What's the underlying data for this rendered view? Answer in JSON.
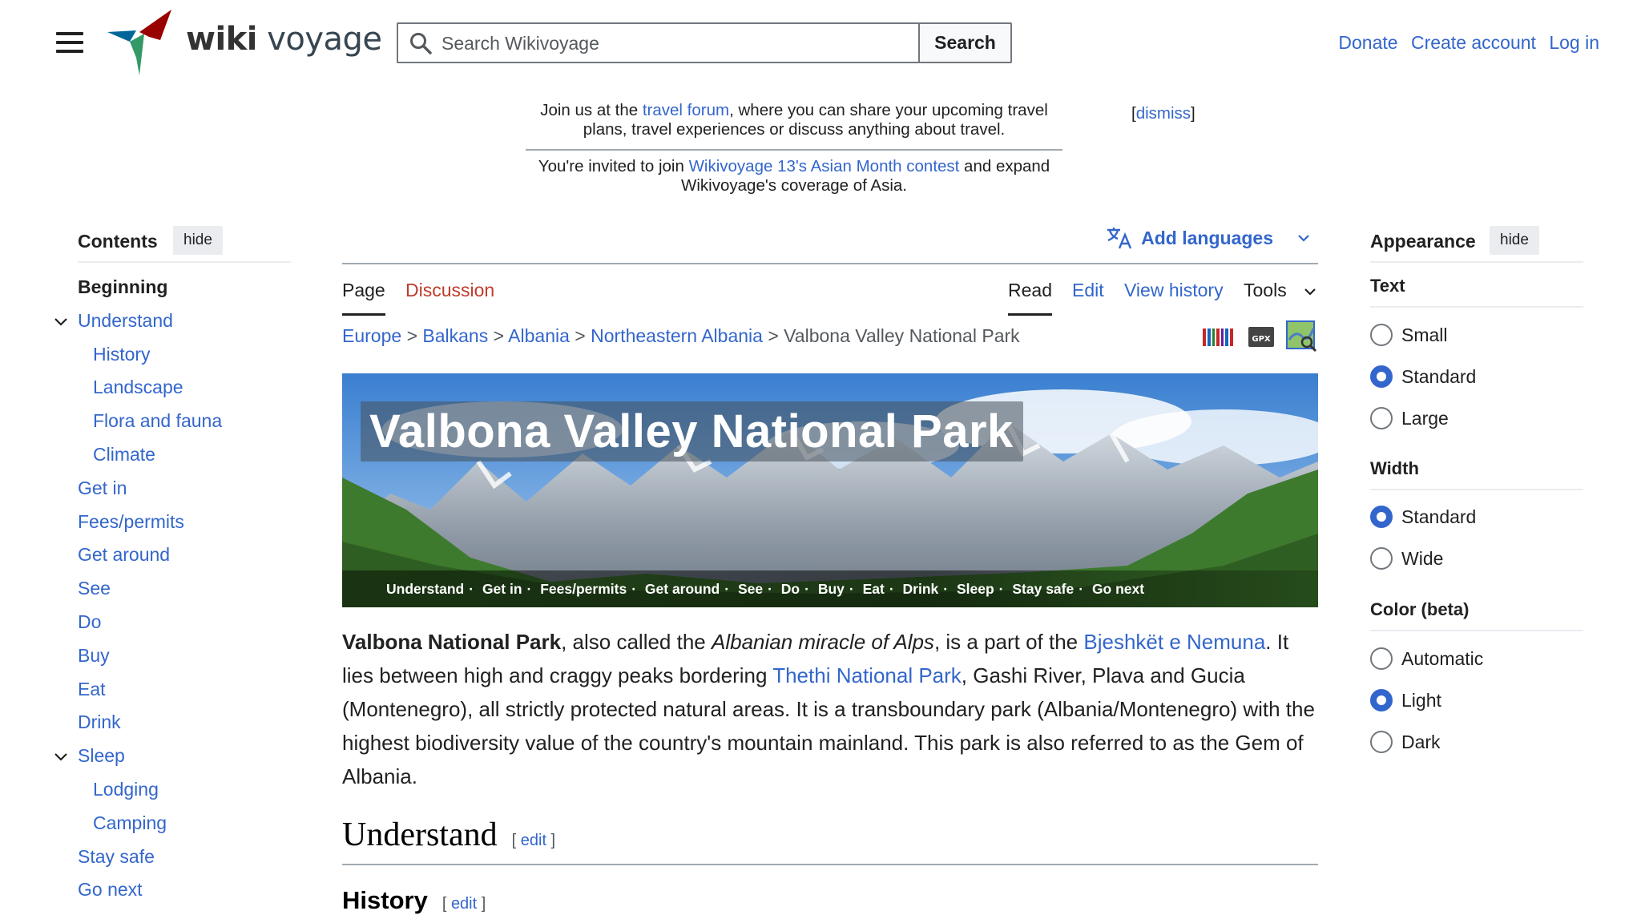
{
  "header": {
    "wordmark_part1": "wiki",
    "wordmark_part2": "voyage",
    "search_placeholder": "Search Wikivoyage",
    "search_button": "Search",
    "donate": "Donate",
    "create_account": "Create account",
    "log_in": "Log in"
  },
  "notices": {
    "n1_pre": "Join us at the ",
    "n1_link": "travel forum",
    "n1_post": ", where you can share your upcoming travel plans, travel experiences or discuss anything about travel.",
    "n2_pre": "You're invited to join ",
    "n2_link": "Wikivoyage 13's Asian Month contest",
    "n2_post": " and expand Wikivoyage's coverage of Asia.",
    "dismiss_open": "[",
    "dismiss": "dismiss",
    "dismiss_close": "]"
  },
  "toc": {
    "title": "Contents",
    "hide": "hide",
    "items": [
      {
        "label": "Beginning"
      },
      {
        "label": "Understand"
      },
      {
        "label": "History"
      },
      {
        "label": "Landscape"
      },
      {
        "label": "Flora and fauna"
      },
      {
        "label": "Climate"
      },
      {
        "label": "Get in"
      },
      {
        "label": "Fees/permits"
      },
      {
        "label": "Get around"
      },
      {
        "label": "See"
      },
      {
        "label": "Do"
      },
      {
        "label": "Buy"
      },
      {
        "label": "Eat"
      },
      {
        "label": "Drink"
      },
      {
        "label": "Sleep"
      },
      {
        "label": "Lodging"
      },
      {
        "label": "Camping"
      },
      {
        "label": "Stay safe"
      },
      {
        "label": "Go next"
      }
    ]
  },
  "main": {
    "add_languages": "Add languages",
    "tabs": {
      "page": "Page",
      "discussion": "Discussion",
      "read": "Read",
      "edit": "Edit",
      "view_history": "View history",
      "tools": "Tools"
    },
    "breadcrumb": [
      "Europe",
      "Balkans",
      "Albania",
      "Northeastern Albania",
      "Valbona Valley National Park"
    ],
    "breadcrumb_sep": ">",
    "banner_title": "Valbona Valley National Park",
    "banner_nav": [
      "Understand",
      "Get in",
      "Fees/permits",
      "Get around",
      "See",
      "Do",
      "Buy",
      "Eat",
      "Drink",
      "Sleep",
      "Stay safe",
      "Go next"
    ],
    "banner_sep": "·",
    "gpx_label": "GPX",
    "intro": {
      "b1": "Valbona National Park",
      "t1": ", also called the ",
      "i1": "Albanian miracle of Alps",
      "t2": ", is a part of the ",
      "l1": "Bjeshkët e Nemuna",
      "t3": ". It lies between high and craggy peaks bordering ",
      "l2": "Thethi National Park",
      "t4": ", Gashi River, Plava and Gucia (Montenegro), all strictly protected natural areas. It is a transboundary park (Albania/Montenegro) with the highest biodiversity value of the country's mountain mainland. This park is also referred to as the Gem of Albania."
    },
    "h2": "Understand",
    "h3": "History",
    "edit_open": "[ ",
    "edit": "edit",
    "edit_close": " ]"
  },
  "appearance": {
    "title": "Appearance",
    "hide": "hide",
    "text_title": "Text",
    "text_options": [
      "Small",
      "Standard",
      "Large"
    ],
    "width_title": "Width",
    "width_options": [
      "Standard",
      "Wide"
    ],
    "color_title": "Color (beta)",
    "color_options": [
      "Automatic",
      "Light",
      "Dark"
    ],
    "selected": {
      "text": "Standard",
      "width": "Standard",
      "color": "Light"
    }
  },
  "colors": {
    "link": "#3366cc",
    "discussion_red": "#bf3c2c",
    "radio_on": "#3366cc"
  }
}
